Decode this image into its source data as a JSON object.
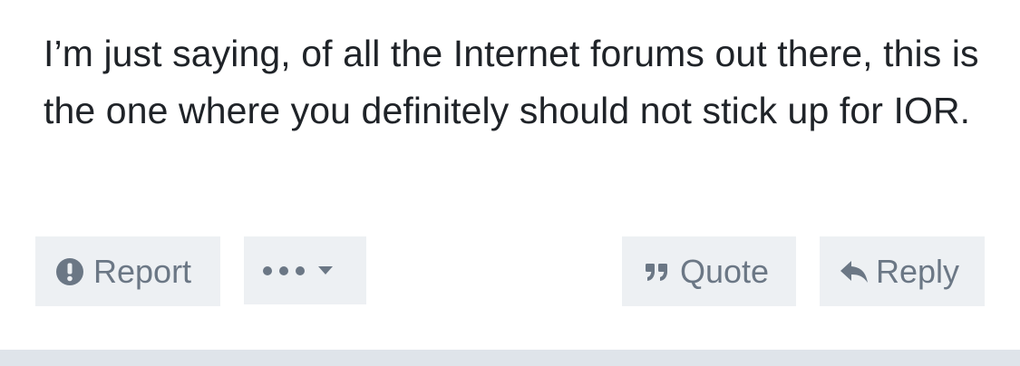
{
  "post": {
    "text": "I’m just saying, of all the Internet forums out there, this is the one where you definitely should not stick up for IOR."
  },
  "actions": {
    "report": {
      "label": "Report",
      "icon": "alert-circle-icon"
    },
    "more": {
      "icon": "ellipsis-icon",
      "caret_icon": "caret-down-icon"
    },
    "quote": {
      "label": "Quote",
      "icon": "quote-icon"
    },
    "reply": {
      "label": "Reply",
      "icon": "reply-arrow-icon"
    }
  },
  "colors": {
    "text": "#1f2328",
    "button_bg": "#edf0f3",
    "button_text": "#6b7785",
    "footer_bar": "#dfe4ea"
  }
}
